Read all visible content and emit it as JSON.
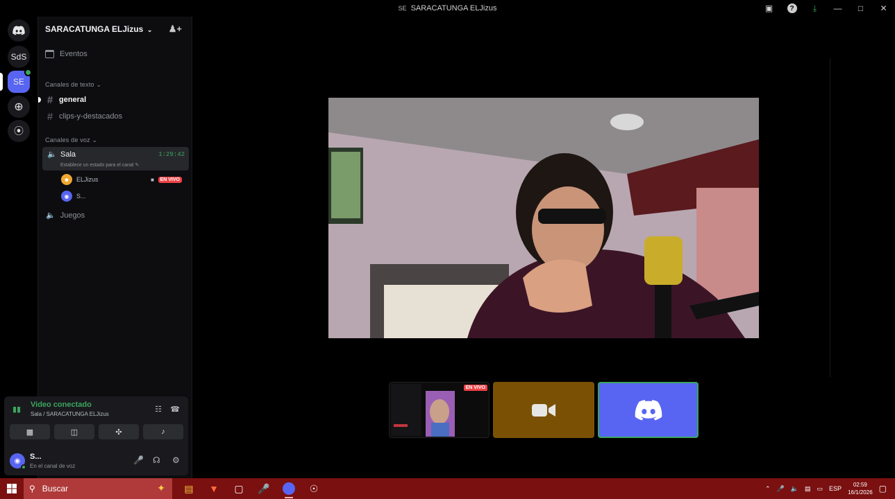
{
  "window": {
    "title": "SARACATUNGA ELJizus"
  },
  "rail": {
    "servers": [
      {
        "label": "SdS"
      },
      {
        "label": "SE"
      }
    ]
  },
  "server": {
    "name": "SARACATUNGA ELJizus",
    "events_label": "Eventos",
    "text_category": "Canales de texto",
    "voice_category": "Canales de voz",
    "text_channels": [
      {
        "name": "general"
      },
      {
        "name": "clips-y-destacados"
      }
    ],
    "voice_channels": [
      {
        "name": "Sala",
        "timer": "1:29:42",
        "status_placeholder": "Establece un estado para el canal",
        "users": [
          {
            "name": "ELJizus",
            "badge": "EN VIVO",
            "avatar_color": "#f0a732"
          },
          {
            "name": "S...",
            "avatar_color": "#5865f2"
          }
        ]
      },
      {
        "name": "Juegos"
      }
    ]
  },
  "voice_panel": {
    "title": "Video conectado",
    "subtitle": "Sala / SARACATUNGA ELJizus"
  },
  "user_panel": {
    "name": "S...",
    "status": "En el canal de voz"
  },
  "stage": {
    "stream_tile_badge": "EN VIVO"
  },
  "taskbar": {
    "search_placeholder": "Buscar",
    "language": "ESP",
    "time": "02:59",
    "date": "16/1/2026"
  },
  "colors": {
    "accent": "#5865f2",
    "online": "#3ba55d",
    "live": "#ed4245",
    "taskbar": "#7a1010"
  }
}
